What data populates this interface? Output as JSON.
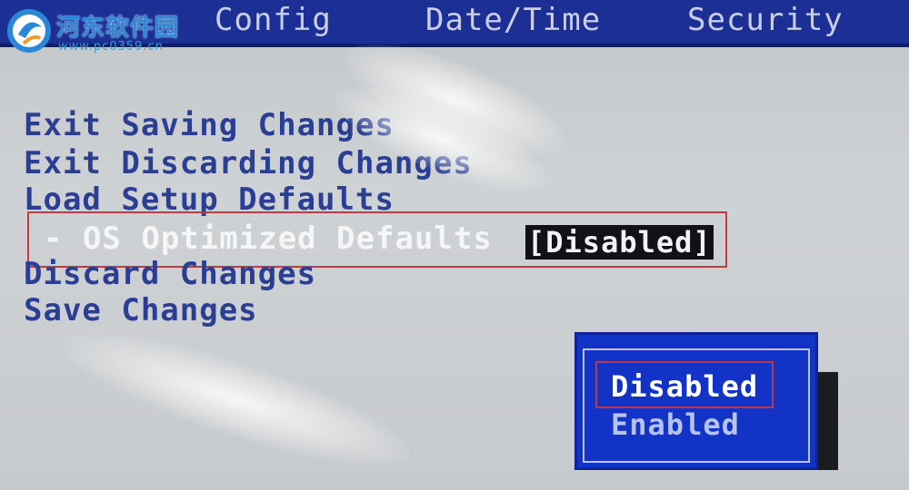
{
  "watermark": {
    "title": "河东软件园",
    "url": "www.pc0359.cn",
    "logo_icon": "hedong-logo-icon"
  },
  "menubar": {
    "tabs": [
      {
        "label": "Config"
      },
      {
        "label": "Date/Time"
      },
      {
        "label": "Security"
      }
    ]
  },
  "exit_menu": {
    "items": [
      {
        "label": "Exit Saving Changes"
      },
      {
        "label": "Exit Discarding Changes"
      },
      {
        "label": "Load Setup Defaults"
      },
      {
        "label": "- OS Optimized Defaults",
        "value": "[Disabled]"
      },
      {
        "label": "Discard Changes"
      },
      {
        "label": "Save Changes"
      }
    ]
  },
  "popup": {
    "options": [
      {
        "label": "Disabled"
      },
      {
        "label": "Enabled"
      }
    ]
  },
  "colors": {
    "menubar_bg": "#1b2f95",
    "screen_bg": "#c7cacd",
    "menu_text": "#2a3f94",
    "popup_bg": "#1233c6",
    "highlight_border": "#c6393f"
  }
}
